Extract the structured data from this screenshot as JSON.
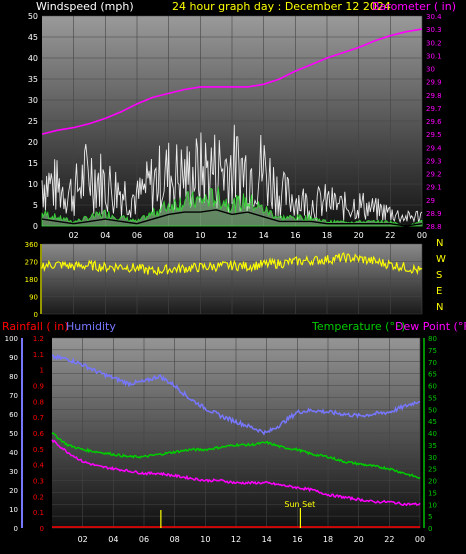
{
  "header": {
    "windspeed_label": "Windspeed (mph)",
    "title": "24 hour graph day : December 12 2024",
    "barometer_label": "Barometer ( in)"
  },
  "colors": {
    "windspeed": "#ffffff",
    "title": "#ffff00",
    "barometer": "#ff00ff",
    "rainfall": "#ff0000",
    "humidity": "#7777ff",
    "temperature": "#00cc00",
    "dewpoint": "#ff00ff",
    "wind_direction": "#ffff00",
    "sunset": "#ffff00"
  },
  "wind_panel": {
    "left_ticks": [
      "0",
      "5",
      "10",
      "15",
      "20",
      "25",
      "30",
      "35",
      "40",
      "45",
      "50"
    ],
    "right_ticks": [
      "28.8",
      "28.9",
      "29",
      "29.1",
      "29.2",
      "29.3",
      "29.4",
      "29.5",
      "29.6",
      "29.7",
      "29.8",
      "29.9",
      "30",
      "30.1",
      "30.2",
      "30.3",
      "30.4"
    ],
    "x_ticks": [
      "02",
      "04",
      "06",
      "08",
      "10",
      "12",
      "14",
      "16",
      "18",
      "20",
      "22",
      "00"
    ]
  },
  "direction_panel": {
    "left_ticks": [
      "0",
      "90",
      "180",
      "270",
      "360"
    ],
    "compass": [
      "N",
      "W",
      "S",
      "E",
      "N"
    ],
    "x_ticks": [
      "02",
      "04",
      "06",
      "08",
      "10",
      "12",
      "14",
      "16",
      "18",
      "20",
      "22",
      "00"
    ]
  },
  "temp_panel": {
    "rainfall_label": "Rainfall ( in)",
    "humidity_label": "Humidity",
    "temperature_label": "Temperature (°F)",
    "dewpoint_label": "Dew Point (°F)",
    "humidity_ticks": [
      "0",
      "10",
      "20",
      "30",
      "40",
      "50",
      "60",
      "70",
      "80",
      "90",
      "100"
    ],
    "rain_ticks": [
      "0",
      "0.1",
      "0.2",
      "0.3",
      "0.4",
      "0.5",
      "0.6",
      "0.7",
      "0.8",
      "0.9",
      "1",
      "1.1",
      "1.2"
    ],
    "temp_ticks": [
      "0",
      "5",
      "10",
      "15",
      "20",
      "25",
      "30",
      "35",
      "40",
      "45",
      "50",
      "55",
      "60",
      "65",
      "70",
      "75",
      "80"
    ],
    "x_ticks": [
      "02",
      "04",
      "06",
      "08",
      "10",
      "12",
      "14",
      "16",
      "18",
      "20",
      "22",
      "00"
    ],
    "sunset_label": "Sun Set"
  },
  "chart_data": [
    {
      "type": "line",
      "title": "24 hour graph day : December 12 2024",
      "x_unit": "hour",
      "ylim_left": [
        0,
        50
      ],
      "ylim_right": [
        28.8,
        30.4
      ],
      "series": [
        {
          "name": "Barometer ( in)",
          "axis": "right",
          "x": [
            0,
            1,
            2,
            3,
            4,
            5,
            6,
            7,
            8,
            9,
            10,
            11,
            12,
            13,
            14,
            15,
            16,
            17,
            18,
            19,
            20,
            21,
            22,
            23,
            24
          ],
          "values": [
            29.5,
            29.53,
            29.55,
            29.58,
            29.62,
            29.67,
            29.73,
            29.78,
            29.81,
            29.84,
            29.86,
            29.86,
            29.86,
            29.86,
            29.88,
            29.92,
            29.98,
            30.03,
            30.08,
            30.12,
            30.16,
            30.21,
            30.25,
            30.28,
            30.3
          ]
        },
        {
          "name": "Wind Gust",
          "axis": "left",
          "x": [
            0,
            1,
            2,
            3,
            4,
            5,
            6,
            7,
            8,
            9,
            10,
            11,
            12,
            13,
            14,
            15,
            16,
            17,
            18,
            19,
            20,
            21,
            22,
            23,
            24
          ],
          "values": [
            17,
            14,
            12,
            20,
            15,
            13,
            10,
            16,
            19,
            18,
            20,
            21,
            22,
            20,
            21,
            12,
            10,
            8,
            9,
            7,
            8,
            6,
            5,
            3,
            4
          ]
        },
        {
          "name": "Wind Speed",
          "axis": "left",
          "x": [
            0,
            1,
            2,
            3,
            4,
            5,
            6,
            7,
            8,
            9,
            10,
            11,
            12,
            13,
            14,
            15,
            16,
            17,
            18,
            19,
            20,
            21,
            22,
            23,
            24
          ],
          "values": [
            3,
            2,
            1,
            2,
            3,
            2,
            1,
            3,
            5,
            6,
            6,
            7,
            5,
            6,
            4,
            2,
            2,
            2,
            1,
            1,
            1,
            1,
            1,
            0,
            1
          ]
        }
      ]
    },
    {
      "type": "scatter",
      "x_unit": "hour",
      "ylim": [
        0,
        360
      ],
      "series": [
        {
          "name": "Wind Direction",
          "x": [
            0,
            1,
            2,
            3,
            4,
            5,
            6,
            7,
            8,
            9,
            10,
            11,
            12,
            13,
            14,
            15,
            16,
            17,
            18,
            19,
            20,
            21,
            22,
            23,
            24
          ],
          "values": [
            250,
            255,
            245,
            250,
            240,
            245,
            235,
            220,
            230,
            235,
            240,
            245,
            250,
            245,
            255,
            260,
            270,
            275,
            280,
            290,
            285,
            270,
            255,
            240,
            220
          ]
        }
      ]
    },
    {
      "type": "line",
      "x_unit": "hour",
      "ylim_humidity": [
        0,
        100
      ],
      "ylim_rain": [
        0,
        1.2
      ],
      "ylim_temp": [
        0,
        80
      ],
      "series": [
        {
          "name": "Humidity",
          "axis": "humidity",
          "x": [
            0,
            1,
            2,
            3,
            4,
            5,
            6,
            7,
            8,
            9,
            10,
            11,
            12,
            13,
            14,
            15,
            16,
            17,
            18,
            19,
            20,
            21,
            22,
            23,
            24
          ],
          "values": [
            90,
            89,
            86,
            82,
            79,
            76,
            77,
            80,
            75,
            68,
            63,
            59,
            56,
            53,
            50,
            55,
            61,
            62,
            61,
            60,
            59,
            60,
            61,
            64,
            67
          ]
        },
        {
          "name": "Temperature (°F)",
          "axis": "temp",
          "x": [
            0,
            1,
            2,
            3,
            4,
            5,
            6,
            7,
            8,
            9,
            10,
            11,
            12,
            13,
            14,
            15,
            16,
            17,
            18,
            19,
            20,
            21,
            22,
            23,
            24
          ],
          "values": [
            40,
            35,
            33,
            32,
            31,
            30,
            30,
            31,
            32,
            33,
            33,
            34,
            35,
            35,
            36,
            34,
            33,
            31,
            30,
            28,
            27,
            26,
            25,
            23,
            21
          ]
        },
        {
          "name": "Dew Point (°F)",
          "axis": "temp",
          "x": [
            0,
            1,
            2,
            3,
            4,
            5,
            6,
            7,
            8,
            9,
            10,
            11,
            12,
            13,
            14,
            15,
            16,
            17,
            18,
            19,
            20,
            21,
            22,
            23,
            24
          ],
          "values": [
            37,
            32,
            28,
            26,
            25,
            24,
            23,
            23,
            22,
            21,
            20,
            20,
            19,
            19,
            19,
            18,
            17,
            16,
            14,
            13,
            12,
            11,
            11,
            10,
            10
          ]
        }
      ],
      "events": [
        {
          "x": 16.2,
          "label": "Sun Set"
        }
      ]
    }
  ]
}
